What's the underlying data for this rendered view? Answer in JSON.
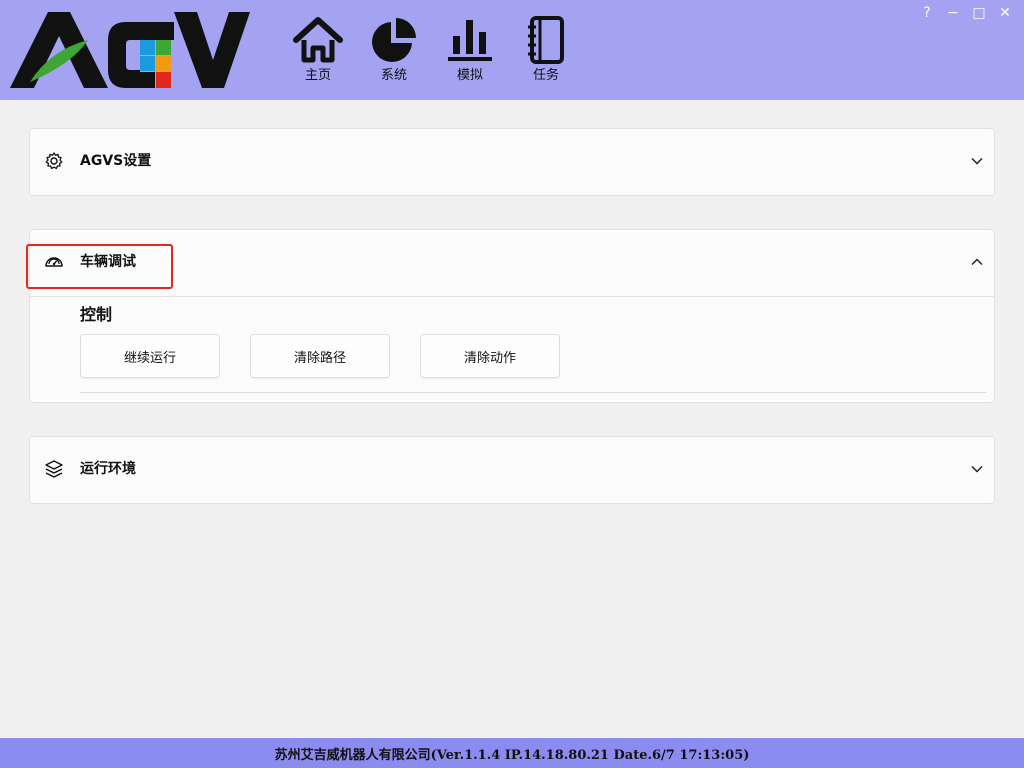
{
  "app": {
    "logo_text": "AGV"
  },
  "nav": {
    "items": [
      {
        "label": "主页",
        "icon": "home-icon"
      },
      {
        "label": "系统",
        "icon": "pie-chart-icon"
      },
      {
        "label": "模拟",
        "icon": "bar-chart-icon"
      },
      {
        "label": "任务",
        "icon": "notebook-icon"
      }
    ]
  },
  "window_controls": {
    "help": "?",
    "minimize": "−",
    "maximize": "□",
    "close": "✕"
  },
  "panels": [
    {
      "title": "AGVS设置",
      "icon": "gear-icon",
      "expanded": false
    },
    {
      "title": "车辆调试",
      "icon": "gauge-icon",
      "expanded": true,
      "section_title": "控制",
      "buttons": [
        "继续运行",
        "清除路径",
        "清除动作"
      ]
    },
    {
      "title": "运行环境",
      "icon": "layers-icon",
      "expanded": false
    }
  ],
  "footer": {
    "status": "苏州艾吉威机器人有限公司(Ver.1.1.4 IP.14.18.80.21 Date.6/7 17:13:05)"
  },
  "colors": {
    "header_bg": "#a3a3f1",
    "footer_bg": "#8c8cf0",
    "highlight": "#e0281f",
    "logo_green": "#3fa535",
    "logo_blue": "#1a9be0",
    "logo_orange": "#f39a14",
    "logo_red": "#e0281f"
  }
}
